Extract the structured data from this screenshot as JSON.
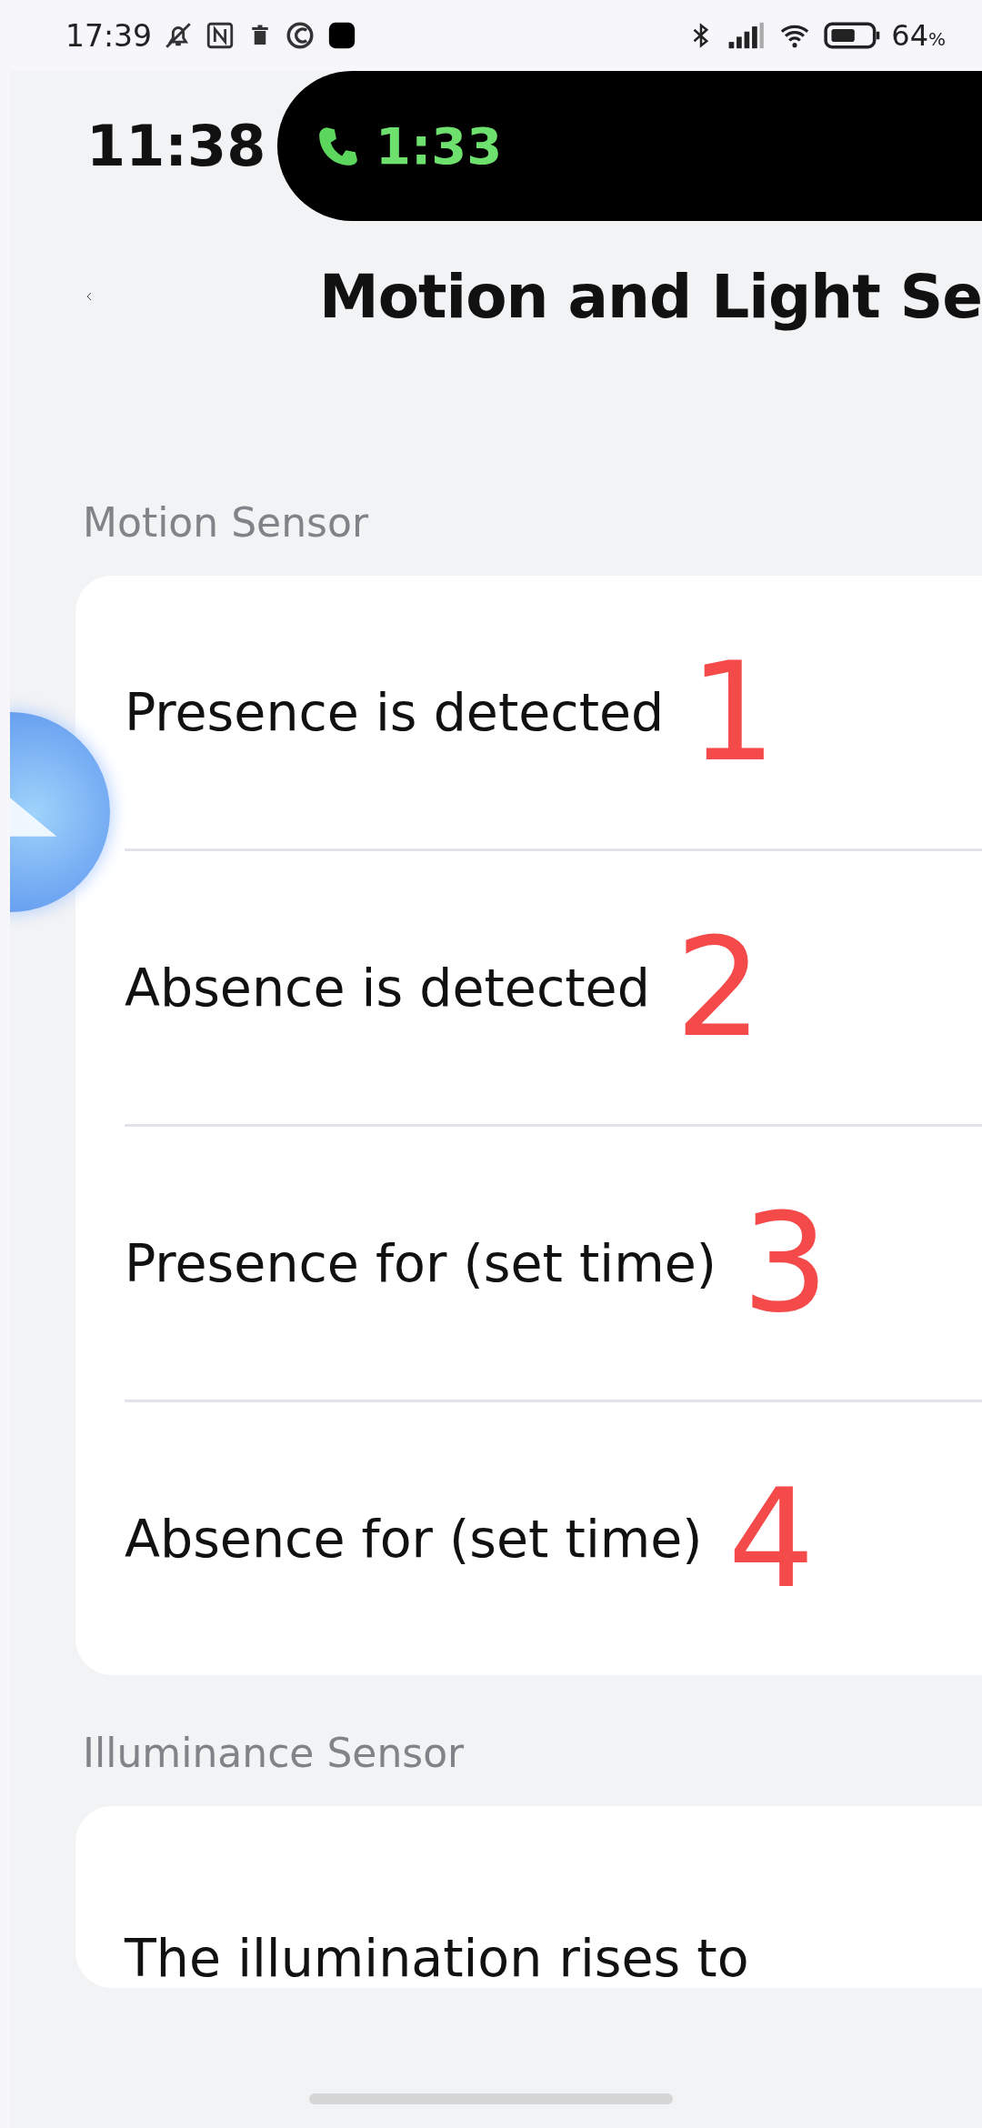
{
  "status_bar": {
    "time": "17:39",
    "battery": "64",
    "battery_unit": "%"
  },
  "inner_status": {
    "time": "11:38",
    "call_time": "1:33"
  },
  "header": {
    "title": "Motion and Light Se"
  },
  "sections": [
    {
      "title": "Motion Sensor",
      "items": [
        {
          "label": "Presence is detected",
          "annotation": "1"
        },
        {
          "label": "Absence is detected",
          "annotation": "2"
        },
        {
          "label": "Presence for (set time)",
          "annotation": "3"
        },
        {
          "label": "Absence for (set time)",
          "annotation": "4"
        }
      ]
    },
    {
      "title": "Illuminance Sensor",
      "items": [
        {
          "label": "The illumination rises to"
        }
      ]
    }
  ]
}
